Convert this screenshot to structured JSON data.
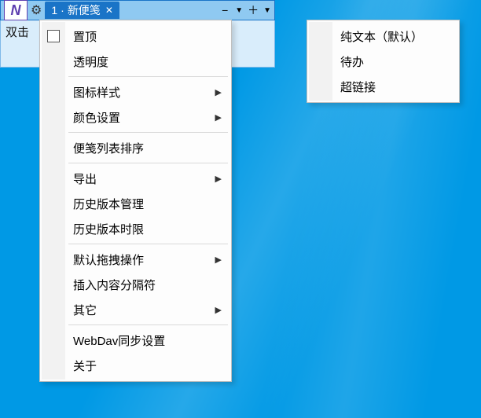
{
  "note": {
    "tab_number": "1",
    "tab_title": "新便笺",
    "body_hint": "双击"
  },
  "main_menu": {
    "items": [
      {
        "label": "置顶",
        "checkbox": true
      },
      {
        "label": "透明度"
      },
      {
        "sep": true
      },
      {
        "label": "图标样式",
        "sub": true
      },
      {
        "label": "颜色设置",
        "sub": true
      },
      {
        "sep": true
      },
      {
        "label": "便笺列表排序"
      },
      {
        "sep": true
      },
      {
        "label": "导出",
        "sub": true
      },
      {
        "label": "历史版本管理"
      },
      {
        "label": "历史版本时限"
      },
      {
        "sep": true
      },
      {
        "label": "默认拖拽操作",
        "sub": true
      },
      {
        "label": "插入内容分隔符"
      },
      {
        "label": "其它",
        "sub": true
      },
      {
        "sep": true
      },
      {
        "label": "WebDav同步设置"
      },
      {
        "label": "关于"
      }
    ]
  },
  "sub_menu": {
    "items": [
      {
        "label": "纯文本（默认）"
      },
      {
        "label": "待办"
      },
      {
        "label": "超链接"
      }
    ]
  }
}
